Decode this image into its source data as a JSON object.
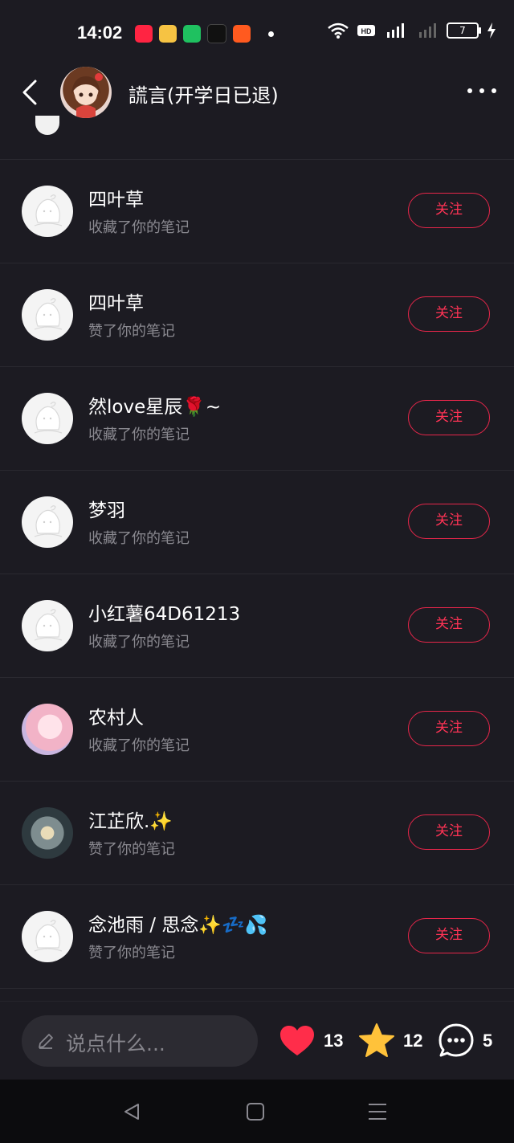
{
  "status_bar": {
    "time": "14:02",
    "battery": "7"
  },
  "header": {
    "title": "謊言(开学日已退)"
  },
  "rows": [
    {
      "name": "四叶草",
      "action": "收藏了你的笔记",
      "button": "关注",
      "avatar": "default"
    },
    {
      "name": "四叶草",
      "action": "赞了你的笔记",
      "button": "关注",
      "avatar": "default"
    },
    {
      "name": "然love星辰🌹~",
      "action": "收藏了你的笔记",
      "button": "关注",
      "avatar": "default"
    },
    {
      "name": "梦羽",
      "action": "收藏了你的笔记",
      "button": "关注",
      "avatar": "default"
    },
    {
      "name": "小红薯64D61213",
      "action": "收藏了你的笔记",
      "button": "关注",
      "avatar": "default"
    },
    {
      "name": "农村人",
      "action": "收藏了你的笔记",
      "button": "关注",
      "avatar": "pink"
    },
    {
      "name": "江芷欣.✨",
      "action": "赞了你的笔记",
      "button": "关注",
      "avatar": "photo"
    },
    {
      "name": "念池雨 / 思念✨💤💦",
      "action": "赞了你的笔记",
      "button": "关注",
      "avatar": "default"
    }
  ],
  "bottom_bar": {
    "input_placeholder": "说点什么...",
    "likes": "13",
    "stars": "12",
    "comments": "5"
  },
  "colors": {
    "accent": "#ff3355",
    "background": "#1c1b22",
    "like": "#ff2d4a",
    "star": "#ffc23a"
  }
}
